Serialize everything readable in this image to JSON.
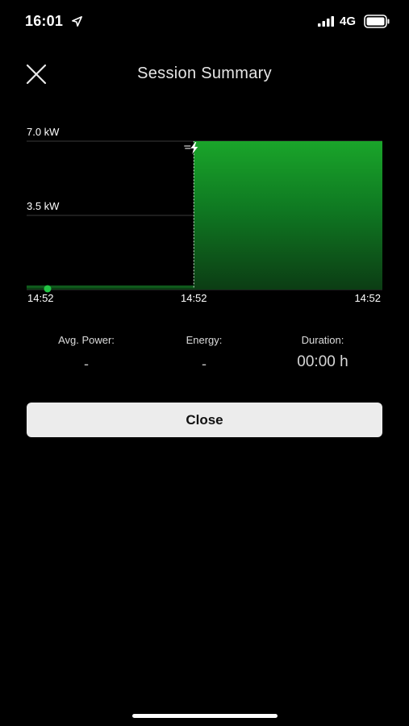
{
  "status_bar": {
    "time": "16:01",
    "network": "4G",
    "icons": [
      "location-arrow-icon",
      "cellular-signal-icon",
      "battery-icon"
    ]
  },
  "header": {
    "title": "Session Summary",
    "close_icon": "close-icon"
  },
  "chart_data": {
    "type": "area",
    "y_ticks": [
      {
        "value": 7.0,
        "label": "7.0 kW"
      },
      {
        "value": 3.5,
        "label": "3.5 kW"
      }
    ],
    "x_ticks": [
      "14:52",
      "14:52",
      "14:52"
    ],
    "ylim": [
      0,
      7.0
    ],
    "series": [
      {
        "values": [
          {
            "x": 0.0,
            "y": 0.1
          },
          {
            "x": 0.47,
            "y": 0.1
          },
          {
            "x": 0.47,
            "y": 7.0
          },
          {
            "x": 1.0,
            "y": 7.0
          }
        ]
      }
    ],
    "grid": true,
    "color": "#1aa52a",
    "start_marker_color": "#22c444",
    "charging_marker_icon": "lightning-bolt-icon"
  },
  "stats": {
    "avg_power": {
      "label": "Avg. Power:",
      "value": "-"
    },
    "energy": {
      "label": "Energy:",
      "value": "-"
    },
    "duration": {
      "label": "Duration:",
      "value": "00:00 h"
    }
  },
  "actions": {
    "close_label": "Close"
  },
  "colors": {
    "background": "#000000",
    "button_background": "#ececec",
    "accent_green": "#1aa52a"
  }
}
